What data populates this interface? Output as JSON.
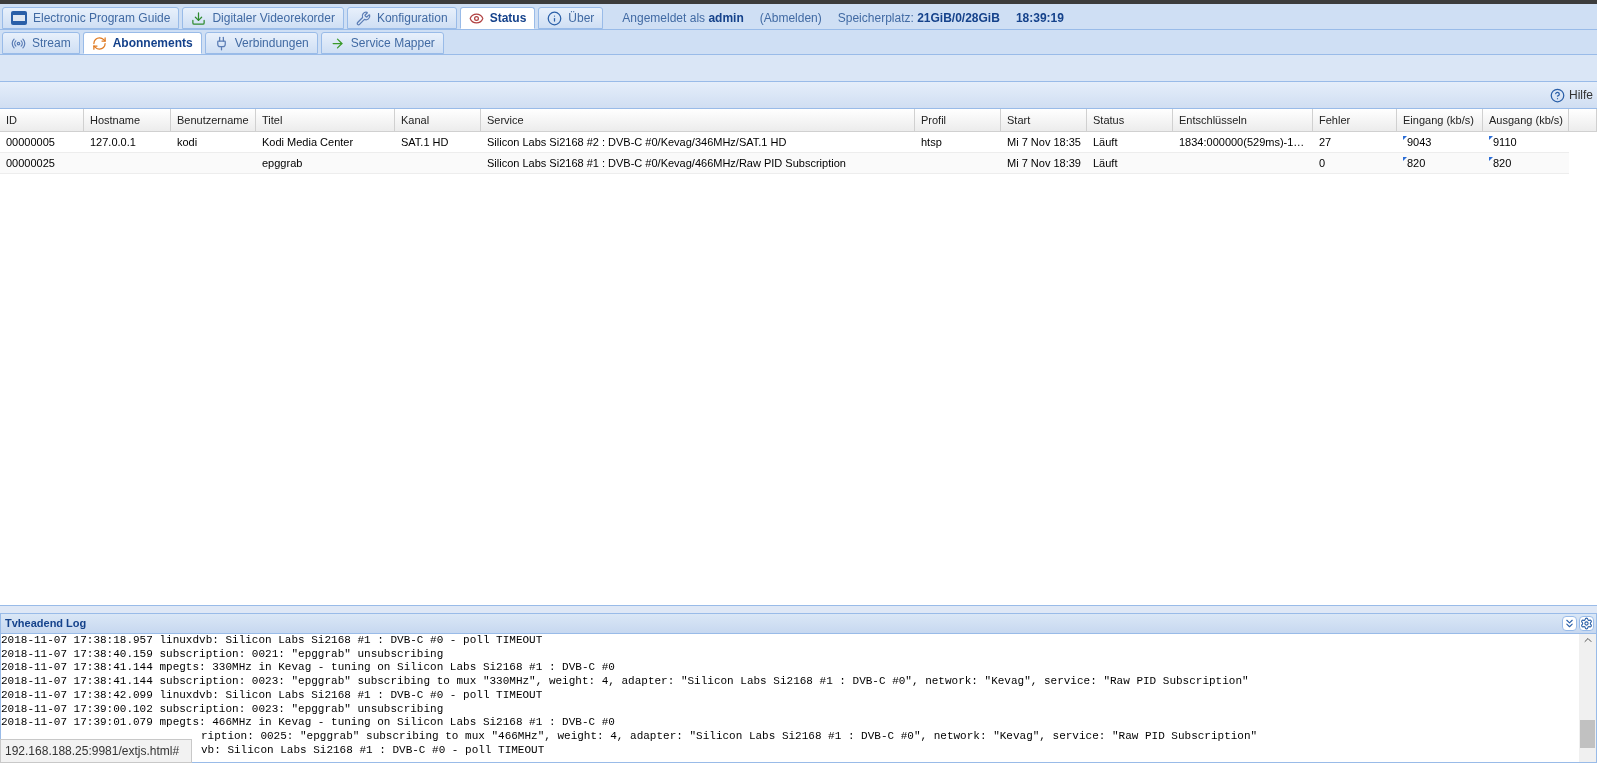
{
  "main_tabs": [
    {
      "label": "Electronic Program Guide",
      "selected": false
    },
    {
      "label": "Digitaler Videorekorder",
      "selected": false
    },
    {
      "label": "Konfiguration",
      "selected": false
    },
    {
      "label": "Status",
      "selected": true
    },
    {
      "label": "Über",
      "selected": false
    }
  ],
  "header_info": {
    "login_label": "Angemeldet als",
    "user": "admin",
    "logout": "(Abmelden)",
    "storage_label": "Speicherplatz:",
    "storage": "21GiB/0/28GiB",
    "time": "18:39:19"
  },
  "sub_tabs": [
    {
      "label": "Stream",
      "selected": false
    },
    {
      "label": "Abonnements",
      "selected": true
    },
    {
      "label": "Verbindungen",
      "selected": false
    },
    {
      "label": "Service Mapper",
      "selected": false
    }
  ],
  "toolbar": {
    "help": "Hilfe"
  },
  "table": {
    "columns": [
      "ID",
      "Hostname",
      "Benutzername",
      "Titel",
      "Kanal",
      "Service",
      "Profil",
      "Start",
      "Status",
      "Entschlüsseln",
      "Fehler",
      "Eingang (kb/s)",
      "Ausgang (kb/s)"
    ],
    "rows": [
      {
        "cells": [
          "00000005",
          "127.0.0.1",
          "kodi",
          "Kodi Media Center",
          "SAT.1 HD",
          "Silicon Labs Si2168 #2 : DVB-C #0/Kevag/346MHz/SAT.1 HD",
          "htsp",
          "Mi 7 Nov 18:35",
          "Läuft",
          "1834:000000(529ms)-1…",
          "27",
          "9043",
          "9110"
        ]
      },
      {
        "cells": [
          "00000025",
          "",
          "",
          "epggrab",
          "",
          "Silicon Labs Si2168 #1 : DVB-C #0/Kevag/466MHz/Raw PID Subscription",
          "",
          "Mi 7 Nov 18:39",
          "Läuft",
          "",
          "0",
          "820",
          "820"
        ]
      }
    ]
  },
  "log": {
    "title": "Tvheadend Log",
    "lines": [
      {
        "kind": "full",
        "text": "2018-11-07 17:38:18.957 linuxdvb: Silicon Labs Si2168 #1 : DVB-C #0 - poll TIMEOUT"
      },
      {
        "kind": "full",
        "text": "2018-11-07 17:38:40.159 subscription: 0021: \"epggrab\" unsubscribing"
      },
      {
        "kind": "full",
        "text": "2018-11-07 17:38:41.144 mpegts: 330MHz in Kevag - tuning on Silicon Labs Si2168 #1 : DVB-C #0"
      },
      {
        "kind": "full",
        "text": "2018-11-07 17:38:41.144 subscription: 0023: \"epggrab\" subscribing to mux \"330MHz\", weight: 4, adapter: \"Silicon Labs Si2168 #1 : DVB-C #0\", network: \"Kevag\", service: \"Raw PID Subscription\""
      },
      {
        "kind": "full",
        "text": "2018-11-07 17:38:42.099 linuxdvb: Silicon Labs Si2168 #1 : DVB-C #0 - poll TIMEOUT"
      },
      {
        "kind": "full",
        "text": "2018-11-07 17:39:00.102 subscription: 0023: \"epggrab\" unsubscribing"
      },
      {
        "kind": "full",
        "text": "2018-11-07 17:39:01.079 mpegts: 466MHz in Kevag - tuning on Silicon Labs Si2168 #1 : DVB-C #0"
      },
      {
        "kind": "covered",
        "text": "ription: 0025: \"epggrab\" subscribing to mux \"466MHz\", weight: 4, adapter: \"Silicon Labs Si2168 #1 : DVB-C #0\", network: \"Kevag\", service: \"Raw PID Subscription\""
      },
      {
        "kind": "covered",
        "text": "vb: Silicon Labs Si2168 #1 : DVB-C #0 - poll TIMEOUT"
      }
    ]
  },
  "status_url": "192.168.188.25:9981/extjs.html#"
}
